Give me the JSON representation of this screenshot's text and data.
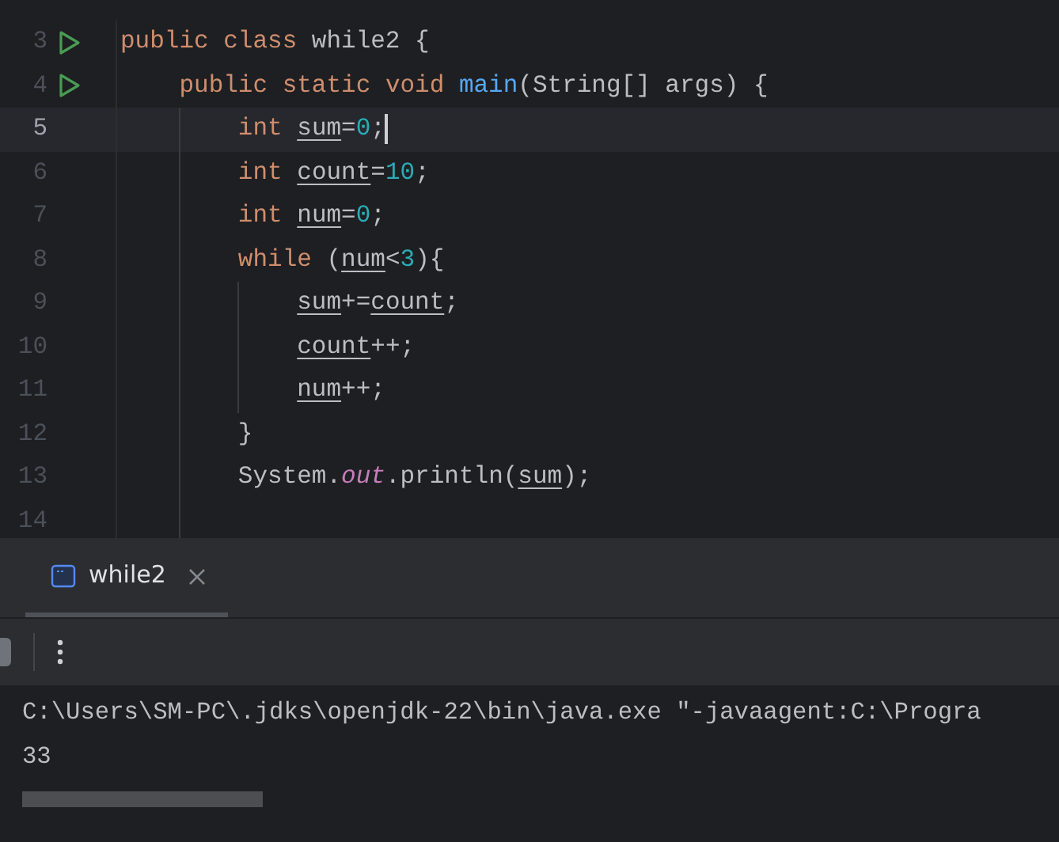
{
  "editor": {
    "lines": [
      {
        "number": "3",
        "runnable": true,
        "current": false,
        "tokens": [
          {
            "text": "public class ",
            "kind": "keyword"
          },
          {
            "text": "while2 {",
            "kind": "plain"
          }
        ]
      },
      {
        "number": "4",
        "runnable": true,
        "current": false,
        "tokens": [
          {
            "text": "    public static void ",
            "kind": "keyword"
          },
          {
            "text": "main",
            "kind": "method"
          },
          {
            "text": "(String[] args) {",
            "kind": "plain"
          }
        ]
      },
      {
        "number": "5",
        "runnable": false,
        "current": true,
        "tokens": [
          {
            "text": "        int ",
            "kind": "keyword"
          },
          {
            "text": "sum",
            "kind": "variable"
          },
          {
            "text": "=",
            "kind": "plain"
          },
          {
            "text": "0",
            "kind": "number"
          },
          {
            "text": ";",
            "kind": "plain"
          }
        ]
      },
      {
        "number": "6",
        "runnable": false,
        "current": false,
        "tokens": [
          {
            "text": "        int ",
            "kind": "keyword"
          },
          {
            "text": "count",
            "kind": "variable"
          },
          {
            "text": "=",
            "kind": "plain"
          },
          {
            "text": "10",
            "kind": "number"
          },
          {
            "text": ";",
            "kind": "plain"
          }
        ]
      },
      {
        "number": "7",
        "runnable": false,
        "current": false,
        "tokens": [
          {
            "text": "        int ",
            "kind": "keyword"
          },
          {
            "text": "num",
            "kind": "variable"
          },
          {
            "text": "=",
            "kind": "plain"
          },
          {
            "text": "0",
            "kind": "number"
          },
          {
            "text": ";",
            "kind": "plain"
          }
        ]
      },
      {
        "number": "8",
        "runnable": false,
        "current": false,
        "tokens": [
          {
            "text": "        while ",
            "kind": "keyword"
          },
          {
            "text": "(",
            "kind": "plain"
          },
          {
            "text": "num",
            "kind": "variable"
          },
          {
            "text": "<",
            "kind": "plain"
          },
          {
            "text": "3",
            "kind": "number"
          },
          {
            "text": "){",
            "kind": "plain"
          }
        ]
      },
      {
        "number": "9",
        "runnable": false,
        "current": false,
        "tokens": [
          {
            "text": "            sum",
            "kind": "variable"
          },
          {
            "text": "+=",
            "kind": "plain"
          },
          {
            "text": "count",
            "kind": "variable"
          },
          {
            "text": ";",
            "kind": "plain"
          }
        ]
      },
      {
        "number": "10",
        "runnable": false,
        "current": false,
        "tokens": [
          {
            "text": "            count",
            "kind": "variable"
          },
          {
            "text": "++;",
            "kind": "plain"
          }
        ]
      },
      {
        "number": "11",
        "runnable": false,
        "current": false,
        "tokens": [
          {
            "text": "            num",
            "kind": "variable"
          },
          {
            "text": "++;",
            "kind": "plain"
          }
        ]
      },
      {
        "number": "12",
        "runnable": false,
        "current": false,
        "tokens": [
          {
            "text": "        }",
            "kind": "plain"
          }
        ]
      },
      {
        "number": "13",
        "runnable": false,
        "current": false,
        "tokens": [
          {
            "text": "        System.",
            "kind": "plain"
          },
          {
            "text": "out",
            "kind": "field"
          },
          {
            "text": ".println(",
            "kind": "plain"
          },
          {
            "text": "sum",
            "kind": "variable"
          },
          {
            "text": ");",
            "kind": "plain"
          }
        ]
      },
      {
        "number": "14",
        "runnable": false,
        "current": false
      }
    ]
  },
  "tool_window": {
    "tabs": [
      {
        "label": "while2",
        "selected": true,
        "closable": true
      }
    ]
  },
  "console": {
    "lines": [
      "C:\\Users\\SM-PC\\.jdks\\openjdk-22\\bin\\java.exe \"-javaagent:C:\\Progra",
      "33"
    ]
  }
}
